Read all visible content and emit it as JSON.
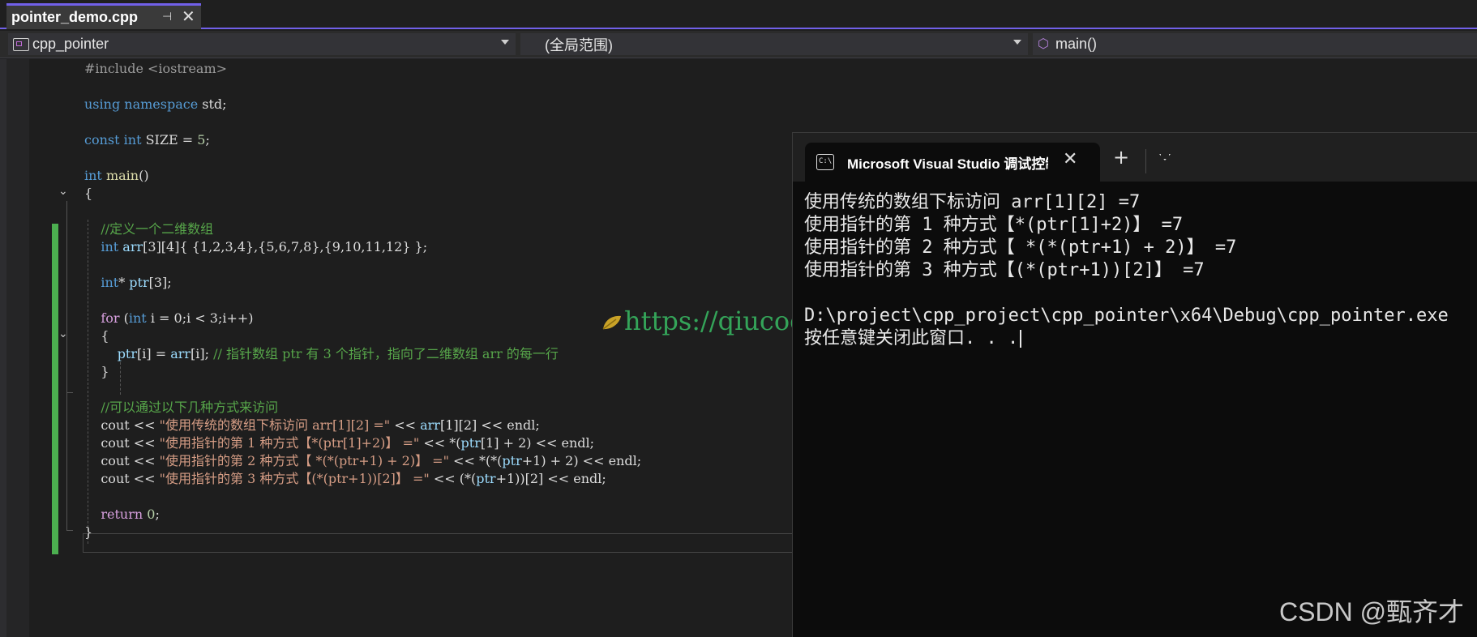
{
  "editor_tab": {
    "file_name": "pointer_demo.cpp",
    "pin_glyph": "⊣",
    "close_glyph": "✕"
  },
  "nav": {
    "project": "cpp_pointer",
    "scope": "(全局范围)",
    "member": "main()"
  },
  "code": [
    [
      {
        "t": "#include <iostream>",
        "c": "pp"
      }
    ],
    [],
    [
      {
        "t": "using",
        "c": "kw"
      },
      {
        "t": " "
      },
      {
        "t": "namespace",
        "c": "kw"
      },
      {
        "t": " std;"
      }
    ],
    [],
    [
      {
        "t": "const",
        "c": "kw"
      },
      {
        "t": " "
      },
      {
        "t": "int",
        "c": "ty"
      },
      {
        "t": " SIZE = "
      },
      {
        "t": "5",
        "c": "nm"
      },
      {
        "t": ";"
      }
    ],
    [],
    [
      {
        "t": "int",
        "c": "ty"
      },
      {
        "t": " "
      },
      {
        "t": "main",
        "c": "fn"
      },
      {
        "t": "()"
      }
    ],
    [
      {
        "t": "{"
      }
    ],
    [],
    [
      {
        "t": "    "
      },
      {
        "t": "//定义一个二维数组",
        "c": "cm"
      }
    ],
    [
      {
        "t": "    "
      },
      {
        "t": "int",
        "c": "ty"
      },
      {
        "t": " "
      },
      {
        "t": "arr",
        "c": "vr"
      },
      {
        "t": "[3][4]{ {1,2,3,4},{5,6,7,8},{9,10,11,12} };"
      }
    ],
    [],
    [
      {
        "t": "    "
      },
      {
        "t": "int",
        "c": "ty"
      },
      {
        "t": "* "
      },
      {
        "t": "ptr",
        "c": "vr"
      },
      {
        "t": "[3];"
      }
    ],
    [],
    [
      {
        "t": "    "
      },
      {
        "t": "for",
        "c": "cf"
      },
      {
        "t": " ("
      },
      {
        "t": "int",
        "c": "ty"
      },
      {
        "t": " i = 0;i < 3;i++)"
      }
    ],
    [
      {
        "t": "    {"
      }
    ],
    [
      {
        "t": "        "
      },
      {
        "t": "ptr",
        "c": "vr"
      },
      {
        "t": "[i] = "
      },
      {
        "t": "arr",
        "c": "vr"
      },
      {
        "t": "[i]; "
      },
      {
        "t": "// 指针数组 ptr 有 3 个指针，指向了二维数组 arr 的每一行",
        "c": "cm"
      }
    ],
    [
      {
        "t": "    }"
      }
    ],
    [],
    [
      {
        "t": "    "
      },
      {
        "t": "//可以通过以下几种方式来访问",
        "c": "cm"
      }
    ],
    [
      {
        "t": "    cout << "
      },
      {
        "t": "\"使用传统的数组下标访问 arr[1][2] =\"",
        "c": "st"
      },
      {
        "t": " << "
      },
      {
        "t": "arr",
        "c": "vr"
      },
      {
        "t": "[1][2] << endl;"
      }
    ],
    [
      {
        "t": "    cout << "
      },
      {
        "t": "\"使用指针的第 1 种方式【*(ptr[1]+2)】 =\"",
        "c": "st"
      },
      {
        "t": " << *("
      },
      {
        "t": "ptr",
        "c": "vr"
      },
      {
        "t": "[1] + 2) << endl;"
      }
    ],
    [
      {
        "t": "    cout << "
      },
      {
        "t": "\"使用指针的第 2 种方式【 *(*(ptr+1) + 2)】 =\"",
        "c": "st"
      },
      {
        "t": " << *(*("
      },
      {
        "t": "ptr",
        "c": "vr"
      },
      {
        "t": "+1) + 2) << endl;"
      }
    ],
    [
      {
        "t": "    cout << "
      },
      {
        "t": "\"使用指针的第 3 种方式【(*(ptr+1))[2]】 =\"",
        "c": "st"
      },
      {
        "t": " << (*("
      },
      {
        "t": "ptr",
        "c": "vr"
      },
      {
        "t": "+1))[2] << endl;"
      }
    ],
    [],
    [
      {
        "t": "    "
      },
      {
        "t": "return",
        "c": "cf"
      },
      {
        "t": " "
      },
      {
        "t": "0",
        "c": "nm"
      },
      {
        "t": ";"
      }
    ],
    [
      {
        "t": "}"
      }
    ]
  ],
  "watermark": "https://qiucode.cn",
  "console": {
    "title": "Microsoft Visual Studio 调试控制台",
    "close_glyph": "✕",
    "add_glyph": "+",
    "output": [
      "使用传统的数组下标访问 arr[1][2] =7",
      "使用指针的第 1 种方式【*(ptr[1]+2)】 =7",
      "使用指针的第 2 种方式【 *(*(ptr+1) + 2)】 =7",
      "使用指针的第 3 种方式【(*(ptr+1))[2]】 =7",
      "",
      "D:\\project\\cpp_project\\cpp_pointer\\x64\\Debug\\cpp_pointer.exe",
      "按任意键关闭此窗口. . ."
    ]
  },
  "credit": "CSDN @甄齐才",
  "colors": {
    "accent": "#7160e8",
    "change_bar": "#4caf50",
    "comment": "#57a64a",
    "keyword": "#569cd6",
    "string": "#d69d85"
  }
}
